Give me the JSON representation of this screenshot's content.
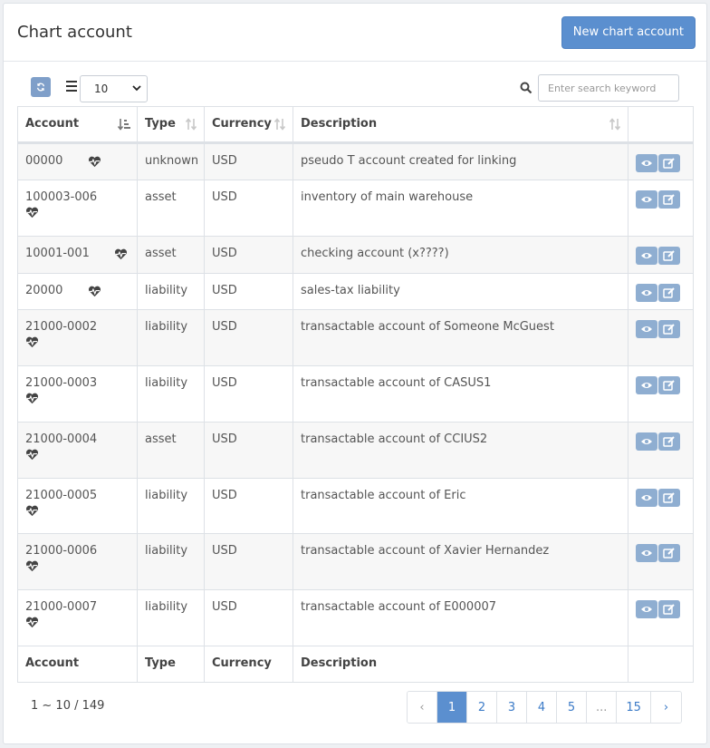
{
  "header": {
    "title": "Chart account",
    "new_button": "New chart account"
  },
  "toolbar": {
    "page_size": "10",
    "search_placeholder": "Enter search keyword"
  },
  "table": {
    "columns": [
      "Account",
      "Type",
      "Currency",
      "Description"
    ],
    "rows": [
      {
        "account": "00000",
        "type": "unknown",
        "currency": "USD",
        "description": "pseudo T account created for linking"
      },
      {
        "account": "100003-006",
        "type": "asset",
        "currency": "USD",
        "description": "inventory of main warehouse"
      },
      {
        "account": "10001-001",
        "type": "asset",
        "currency": "USD",
        "description": "checking account (x????)"
      },
      {
        "account": "20000",
        "type": "liability",
        "currency": "USD",
        "description": "sales-tax liability"
      },
      {
        "account": "21000-0002",
        "type": "liability",
        "currency": "USD",
        "description": "transactable account of Someone McGuest"
      },
      {
        "account": "21000-0003",
        "type": "liability",
        "currency": "USD",
        "description": "transactable account of CASUS1"
      },
      {
        "account": "21000-0004",
        "type": "asset",
        "currency": "USD",
        "description": "transactable account of CCIUS2"
      },
      {
        "account": "21000-0005",
        "type": "liability",
        "currency": "USD",
        "description": "transactable account of Eric"
      },
      {
        "account": "21000-0006",
        "type": "liability",
        "currency": "USD",
        "description": "transactable account of Xavier Hernandez"
      },
      {
        "account": "21000-0007",
        "type": "liability",
        "currency": "USD",
        "description": "transactable account of E000007"
      }
    ]
  },
  "pagination": {
    "info": "1 ~ 10 / 149",
    "prev": "‹",
    "pages": [
      "1",
      "2",
      "3",
      "4",
      "5",
      "...",
      "15"
    ],
    "next": "›",
    "active": "1"
  },
  "icons": {
    "refresh": "refresh-icon",
    "list": "list-icon",
    "search": "search-icon",
    "heartbeat": "heartbeat-icon",
    "view": "eye-icon",
    "edit": "edit-icon"
  }
}
